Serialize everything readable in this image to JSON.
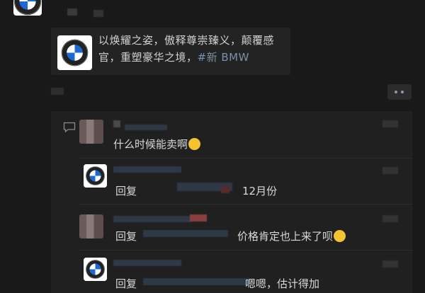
{
  "post": {
    "text": "以焕耀之姿，傲释尊崇臻义，颠覆感官，重塑豪华之境，",
    "hashtag": "#新 BMW"
  },
  "comments": [
    {
      "text": "什么时候能卖啊",
      "emoji": "thinking-emoji"
    },
    {
      "reply_label": "回复",
      "text": "12月份"
    },
    {
      "reply_label": "回复",
      "text": "价格肯定也上来了呗",
      "emoji": "laughing-emoji"
    },
    {
      "reply_label": "回复",
      "text": "嗯嗯，估计得加"
    }
  ],
  "colors": {
    "background": "#191919",
    "card": "#232323",
    "panel": "#202020",
    "hashtag": "#7d90a9",
    "bmw_blue": "#1c69d4"
  }
}
